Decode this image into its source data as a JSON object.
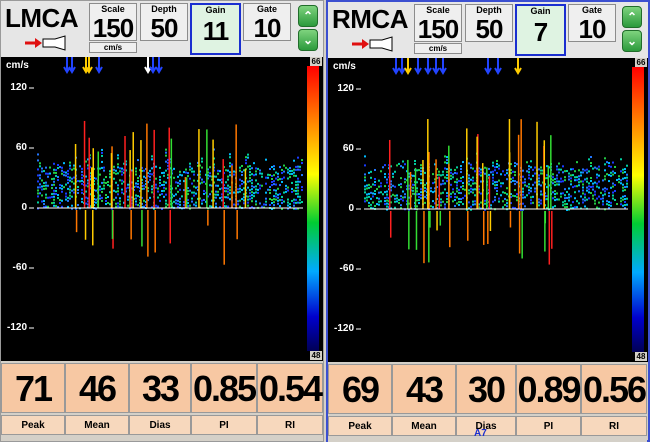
{
  "panels": [
    {
      "vessel": "LMCA",
      "params": {
        "scale": {
          "label": "Scale",
          "value": "150",
          "unit": "cm/s"
        },
        "depth": {
          "label": "Depth",
          "value": "50"
        },
        "gain": {
          "label": "Gain",
          "value": "11"
        },
        "gate": {
          "label": "Gate",
          "value": "10"
        }
      },
      "plot": {
        "unit_label": "cm/s",
        "y_ticks": [
          "120",
          "60",
          "0",
          "-60",
          "-120"
        ],
        "colorbar_top": "66",
        "colorbar_bottom": "48"
      },
      "measurements": [
        {
          "label": "Peak",
          "value": "71"
        },
        {
          "label": "Mean",
          "value": "46"
        },
        {
          "label": "Dias",
          "value": "33"
        },
        {
          "label": "PI",
          "value": "0.85"
        },
        {
          "label": "RI",
          "value": "0.54"
        }
      ]
    },
    {
      "vessel": "RMCA",
      "params": {
        "scale": {
          "label": "Scale",
          "value": "150",
          "unit": "cm/s"
        },
        "depth": {
          "label": "Depth",
          "value": "50"
        },
        "gain": {
          "label": "Gain",
          "value": "7"
        },
        "gate": {
          "label": "Gate",
          "value": "10"
        }
      },
      "plot": {
        "unit_label": "cm/s",
        "y_ticks": [
          "120",
          "60",
          "0",
          "-60",
          "-120"
        ],
        "colorbar_top": "66",
        "colorbar_bottom": "48"
      },
      "measurements": [
        {
          "label": "Peak",
          "value": "69"
        },
        {
          "label": "Mean",
          "value": "43"
        },
        {
          "label": "Dias",
          "value": "30"
        },
        {
          "label": "PI",
          "value": "0.89"
        },
        {
          "label": "RI",
          "value": "0.56"
        }
      ],
      "footer_note": "A7"
    }
  ],
  "icons": {
    "param_up": "chevron-up-icon",
    "param_down": "chevron-down-icon",
    "probe": "probe-icon"
  },
  "colors": {
    "measurement_bg": "#f7c8a3",
    "selected_border": "#1a2fd0",
    "active_panel_border": "#3b4fd0"
  }
}
